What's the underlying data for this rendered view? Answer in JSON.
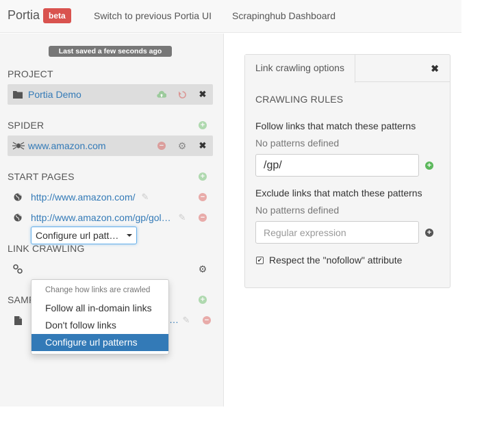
{
  "navbar": {
    "brand": "Portia",
    "badge": "beta",
    "links": [
      "Switch to previous Portia UI",
      "Scrapinghub Dashboard"
    ]
  },
  "sidebar": {
    "saved_status": "Last saved a few seconds ago",
    "project": {
      "heading": "PROJECT",
      "name": "Portia Demo"
    },
    "spider": {
      "heading": "SPIDER",
      "name": "www.amazon.com"
    },
    "start_pages": {
      "heading": "START PAGES",
      "items": [
        "http://www.amazon.com/",
        "http://www.amazon.com/gp/gol…"
      ]
    },
    "link_crawling": {
      "heading": "LINK CRAWLING",
      "selected": "Configure url patt…"
    },
    "samples": {
      "heading": "SAMP",
      "item_suffix": "…"
    }
  },
  "dropdown": {
    "header": "Change how links are crawled",
    "options": [
      "Follow all in-domain links",
      "Don't follow links",
      "Configure url patterns"
    ],
    "active_index": 2
  },
  "panel": {
    "tab_label": "Link crawling options",
    "section_title": "CRAWLING RULES",
    "follow": {
      "label": "Follow links that match these patterns",
      "none_text": "No patterns defined",
      "value": "/gp/"
    },
    "exclude": {
      "label": "Exclude links that match these patterns",
      "none_text": "No patterns defined",
      "placeholder": "Regular expression"
    },
    "nofollow_label": "Respect the \"nofollow\" attribute",
    "nofollow_checked": true
  },
  "colors": {
    "link": "#337ab7",
    "badge": "#d9534f",
    "add": "#5cb85c",
    "remove": "#d9534f",
    "active": "#337ab7"
  }
}
